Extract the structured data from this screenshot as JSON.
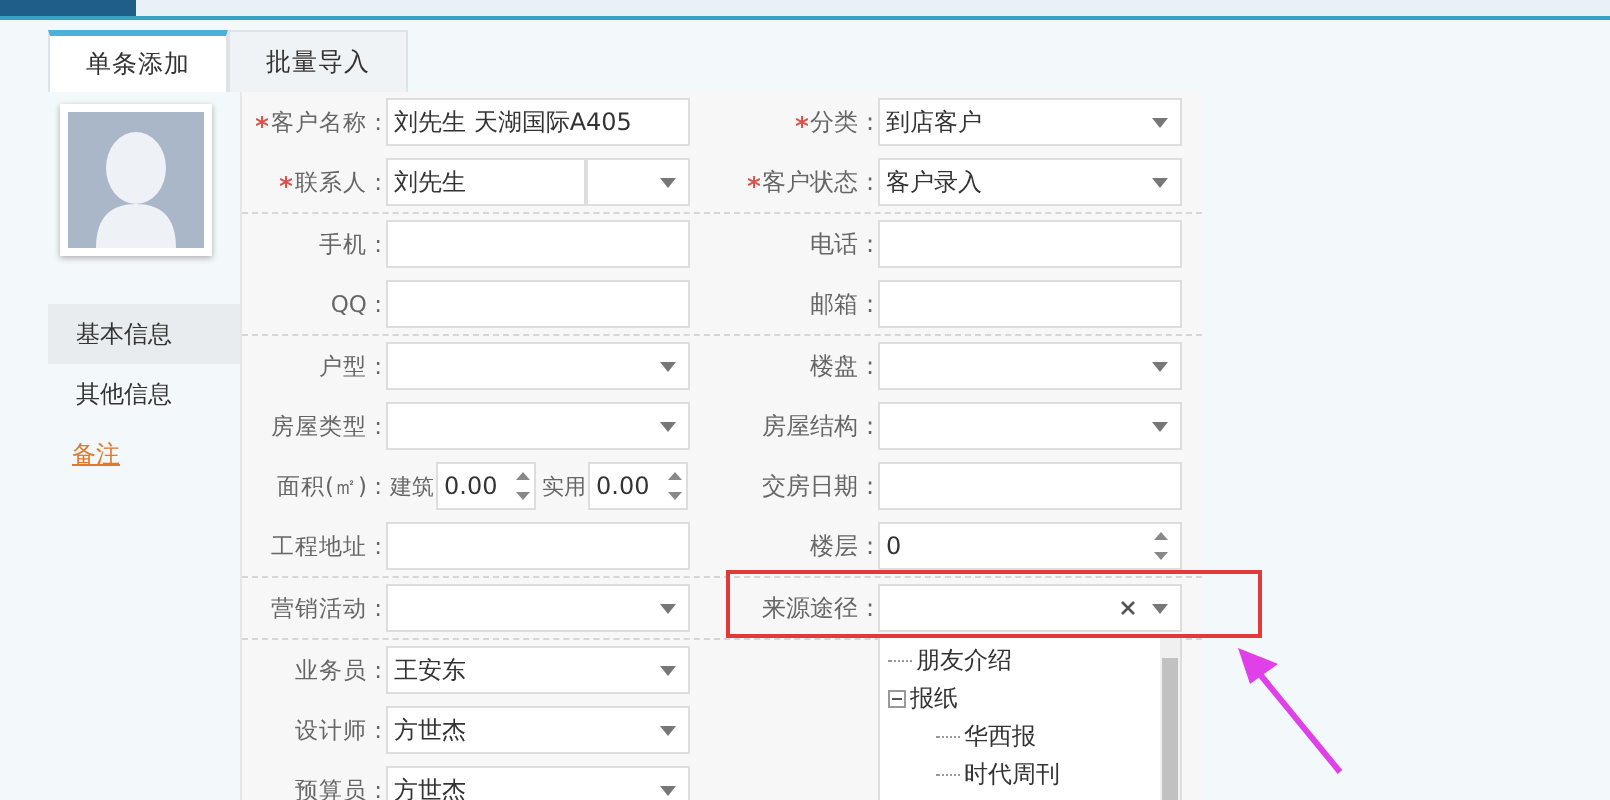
{
  "tabs": [
    {
      "label": "单条添加",
      "selected": true
    },
    {
      "label": "批量导入",
      "selected": false
    }
  ],
  "sidebar": {
    "menu": [
      {
        "label": "基本信息",
        "selected": true,
        "kind": "item"
      },
      {
        "label": "其他信息",
        "selected": false,
        "kind": "item"
      },
      {
        "label": "备注",
        "selected": false,
        "kind": "link"
      }
    ]
  },
  "form": {
    "groups": [
      [
        {
          "left": {
            "label": "客户名称 :",
            "required": true,
            "kind": "text",
            "value": "刘先生 天湖国际A405"
          },
          "right": {
            "label": "分类 :",
            "required": true,
            "kind": "select",
            "value": "到店客户"
          }
        },
        {
          "left": {
            "label": "联系人 :",
            "required": true,
            "kind": "contact",
            "value": "刘先生"
          },
          "right": {
            "label": "客户状态 :",
            "required": true,
            "kind": "select",
            "value": "客户录入"
          }
        }
      ],
      [
        {
          "left": {
            "label": "手机 :",
            "kind": "text"
          },
          "right": {
            "label": "电话 :",
            "kind": "text"
          }
        },
        {
          "left": {
            "label": "QQ :",
            "kind": "text"
          },
          "right": {
            "label": "邮箱 :",
            "kind": "text"
          }
        }
      ],
      [
        {
          "left": {
            "label": "户型 :",
            "kind": "select"
          },
          "right": {
            "label": "楼盘 :",
            "kind": "select"
          }
        },
        {
          "left": {
            "label": "房屋类型 :",
            "kind": "select"
          },
          "right": {
            "label": "房屋结构 :",
            "kind": "select"
          }
        },
        {
          "left": {
            "label": "面积(㎡) :",
            "kind": "area",
            "parts": [
              {
                "label": "建筑",
                "value": "0.00"
              },
              {
                "label": "实用",
                "value": "0.00"
              }
            ]
          },
          "right": {
            "label": "交房日期 :",
            "kind": "text"
          }
        },
        {
          "left": {
            "label": "工程地址 :",
            "kind": "text"
          },
          "right": {
            "label": "楼层 :",
            "kind": "spin",
            "value": "0"
          }
        }
      ],
      [
        {
          "left": {
            "label": "营销活动 :",
            "kind": "select"
          },
          "right": {
            "label": "来源途径 :",
            "kind": "combo",
            "highlighted": true,
            "tree": [
              {
                "label": "朋友介绍"
              },
              {
                "label": "报纸",
                "expanded": true,
                "children": [
                  {
                    "label": "华西报"
                  },
                  {
                    "label": "时代周刊"
                  }
                ]
              }
            ]
          }
        }
      ],
      [
        {
          "left": {
            "label": "业务员 :",
            "kind": "select",
            "value": "王安东"
          }
        },
        {
          "left": {
            "label": "设计师 :",
            "kind": "select",
            "value": "方世杰"
          }
        },
        {
          "left": {
            "label": "预算员 :",
            "kind": "select",
            "value": "方世杰"
          }
        }
      ]
    ]
  }
}
